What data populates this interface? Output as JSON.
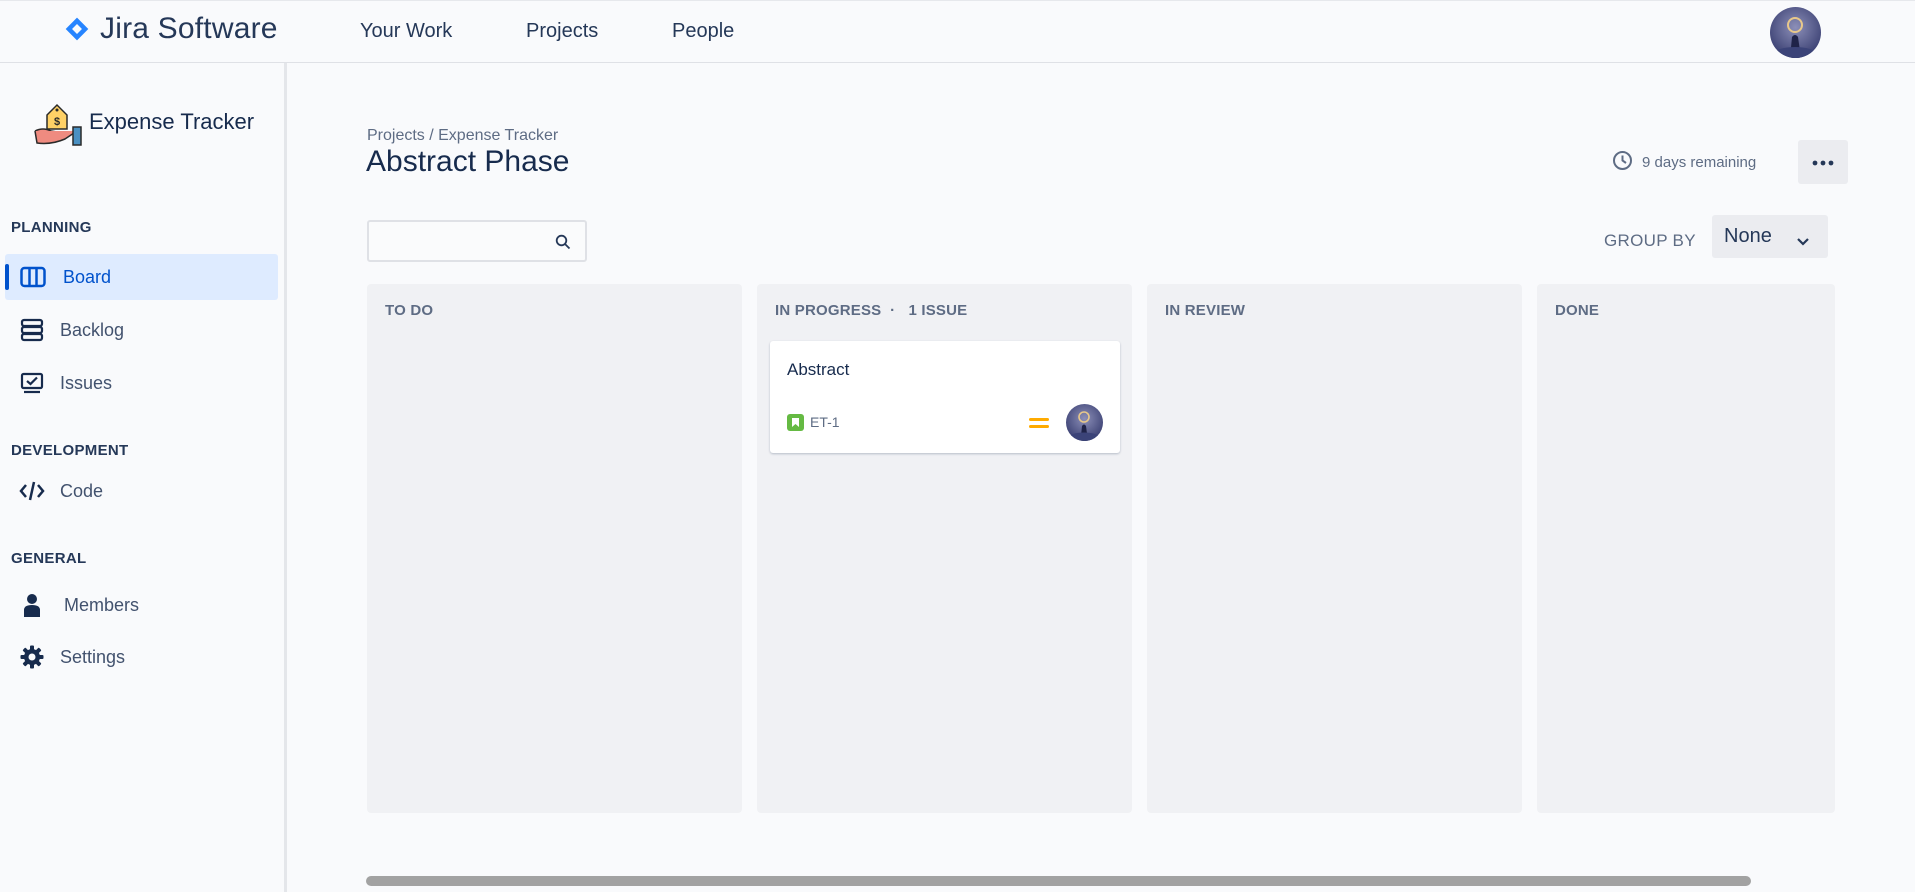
{
  "topbar": {
    "app_name": "Jira Software",
    "nav": [
      "Your Work",
      "Projects",
      "People"
    ]
  },
  "sidebar": {
    "project_name": "Expense Tracker",
    "sections": [
      {
        "title": "PLANNING",
        "items": [
          {
            "label": "Board",
            "icon": "board-icon",
            "active": true
          },
          {
            "label": "Backlog",
            "icon": "backlog-icon"
          },
          {
            "label": "Issues",
            "icon": "issues-icon"
          }
        ]
      },
      {
        "title": "DEVELOPMENT",
        "items": [
          {
            "label": "Code",
            "icon": "code-icon"
          }
        ]
      },
      {
        "title": "GENERAL",
        "items": [
          {
            "label": "Members",
            "icon": "member-icon"
          },
          {
            "label": "Settings",
            "icon": "gear-icon"
          }
        ]
      }
    ]
  },
  "header": {
    "breadcrumb": "Projects / Expense Tracker",
    "title": "Abstract Phase",
    "remaining": "9 days remaining"
  },
  "search": {
    "value": "",
    "placeholder": ""
  },
  "group_by": {
    "label": "GROUP BY",
    "selected": "None"
  },
  "board": {
    "columns": [
      {
        "title": "TO DO",
        "count": "",
        "cards": []
      },
      {
        "title": "IN PROGRESS",
        "separator": "·",
        "count": "1 ISSUE",
        "cards": [
          {
            "title": "Abstract",
            "key": "ET-1",
            "type": "story",
            "priority": "medium"
          }
        ]
      },
      {
        "title": "IN REVIEW",
        "count": "",
        "cards": []
      },
      {
        "title": "DONE",
        "count": "",
        "cards": []
      }
    ]
  },
  "colors": {
    "accent": "#0052cc",
    "story": "#65ba43",
    "priority_medium": "#ffab00",
    "column_bg": "#f0f1f4"
  }
}
